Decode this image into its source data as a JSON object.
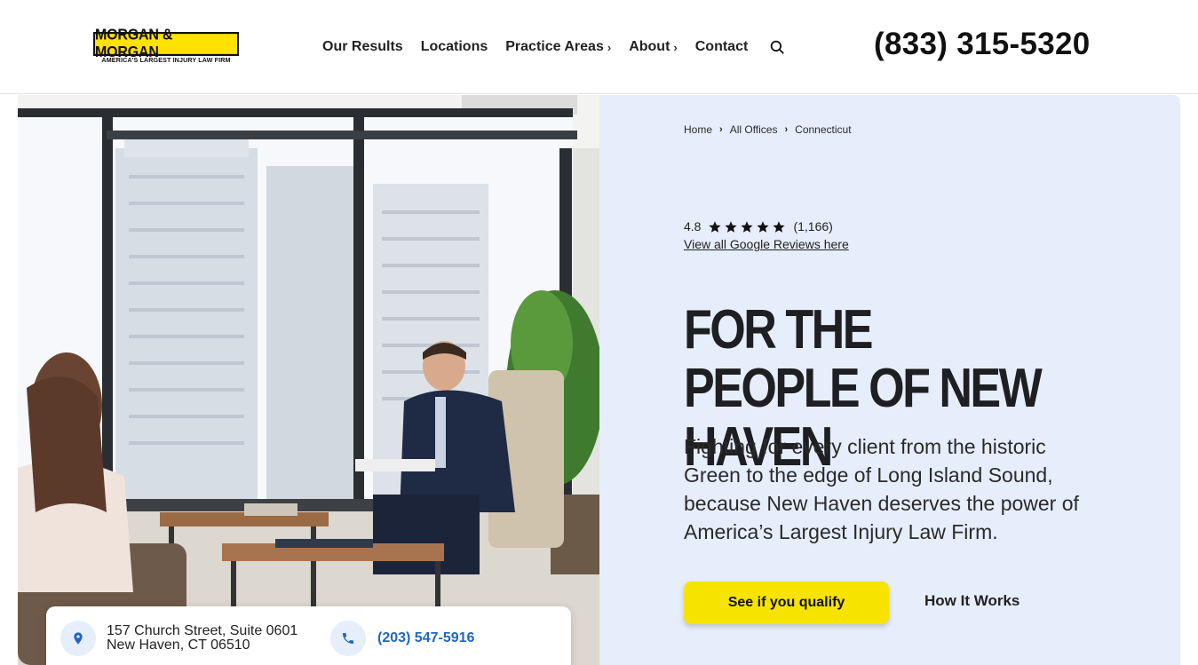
{
  "header": {
    "logo_text": "MORGAN & MORGAN",
    "logo_tagline": "AMERICA'S LARGEST INJURY LAW FIRM",
    "nav": [
      {
        "label": "Our Results",
        "has_chevron": false
      },
      {
        "label": "Locations",
        "has_chevron": false
      },
      {
        "label": "Practice Areas",
        "has_chevron": true
      },
      {
        "label": "About",
        "has_chevron": true
      },
      {
        "label": "Contact",
        "has_chevron": false
      }
    ],
    "search_icon": "search-icon",
    "phone": "(833) 315-5320"
  },
  "hero": {
    "breadcrumb": [
      "Home",
      "All Offices",
      "Connecticut"
    ],
    "rating": {
      "score": "4.8",
      "stars": 5,
      "count": "(1,166)"
    },
    "reviews_link": "View all Google Reviews here",
    "headline": "For the People of New Haven",
    "subtext": "Fighting for every client from the historic Green to the edge of Long Island Sound, because New Haven deserves the power of America’s Largest Injury Law Firm.",
    "cta_primary": "See if you qualify",
    "cta_secondary": "How It Works"
  },
  "contact_card": {
    "address_line1": "157 Church Street, Suite 0601",
    "address_line2": "New Haven, CT 06510",
    "phone": "(203) 547-5916"
  },
  "colors": {
    "brand_yellow": "#f7e300",
    "panel_bg": "#e6edfb",
    "link_blue": "#1f66c4",
    "text_dark": "#1e1f22"
  }
}
